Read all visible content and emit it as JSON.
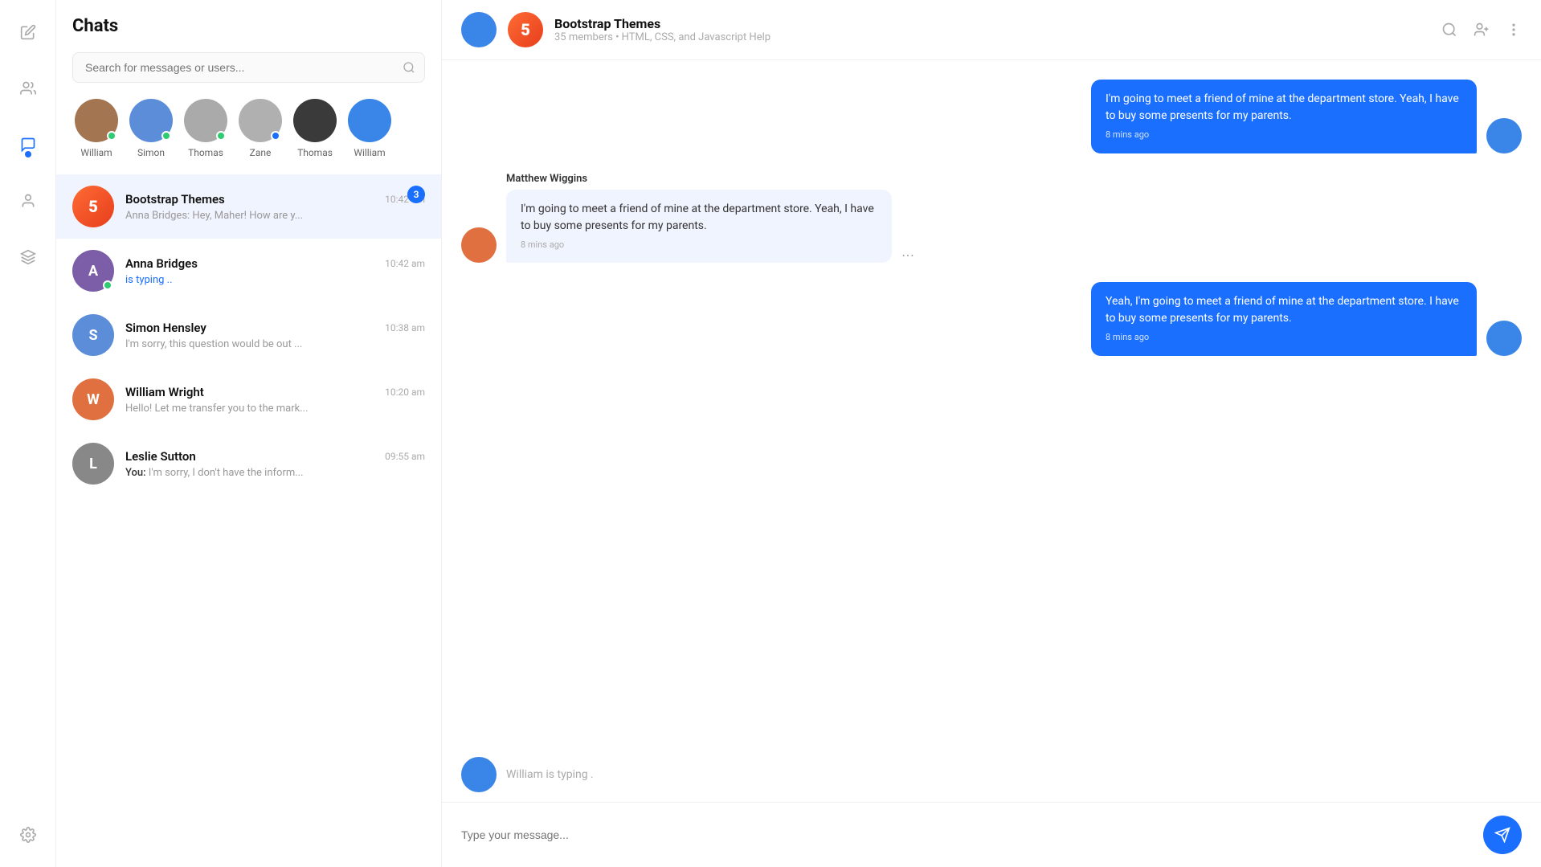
{
  "app": {
    "title": "Chats"
  },
  "nav": {
    "icons": [
      {
        "name": "edit-icon",
        "label": "Edit"
      },
      {
        "name": "contacts-icon",
        "label": "Contacts"
      },
      {
        "name": "chat-icon",
        "label": "Chat",
        "active": true
      },
      {
        "name": "user-icon",
        "label": "User"
      },
      {
        "name": "layers-icon",
        "label": "Layers"
      }
    ],
    "bottom": [
      {
        "name": "settings-icon",
        "label": "Settings"
      }
    ]
  },
  "sidebar": {
    "title": "Chats",
    "search": {
      "placeholder": "Search for messages or users..."
    },
    "active_users": [
      {
        "id": "william",
        "name": "William",
        "color": "#a47551",
        "online": true,
        "dot": "green"
      },
      {
        "id": "simon",
        "name": "Simon",
        "color": "#5b8dd9",
        "online": true,
        "dot": "green"
      },
      {
        "id": "thomas1",
        "name": "Thomas",
        "color": "#888",
        "online": true,
        "dot": "green"
      },
      {
        "id": "zane",
        "name": "Zane",
        "color": "#b0b0b0",
        "online": true,
        "dot": "blue"
      },
      {
        "id": "thomas2",
        "name": "Thomas",
        "color": "#3a3a3a",
        "online": false,
        "dot": ""
      },
      {
        "id": "william2",
        "name": "William",
        "color": "#3a86e8",
        "online": false,
        "dot": ""
      }
    ],
    "chats": [
      {
        "id": "bootstrap-themes",
        "name": "Bootstrap Themes",
        "time": "10:42 am",
        "preview": "Anna Bridges: Hey, Maher! How are y...",
        "badge": "3",
        "is_group": true,
        "group_color": "#e63e1c",
        "group_icon": "5"
      },
      {
        "id": "anna-bridges",
        "name": "Anna Bridges",
        "time": "10:42 am",
        "preview": "is typing ..",
        "typing": true,
        "color": "#7b5ea7",
        "online": true
      },
      {
        "id": "simon-hensley",
        "name": "Simon Hensley",
        "time": "10:38 am",
        "preview": "I'm sorry, this question would be out ...",
        "color": "#5b8dd9"
      },
      {
        "id": "william-wright",
        "name": "William Wright",
        "time": "10:20 am",
        "preview": "Hello! Let me transfer you to the mark...",
        "color": "#e07040"
      },
      {
        "id": "leslie-sutton",
        "name": "Leslie Sutton",
        "time": "09:55 am",
        "preview_label": "You:",
        "preview": " I'm sorry, I don't have the inform...",
        "color": "#666"
      }
    ]
  },
  "chat_header": {
    "name": "Bootstrap Themes",
    "sub": "35 members  •  HTML, CSS, and Javascript Help"
  },
  "messages": [
    {
      "id": "msg1",
      "type": "outgoing",
      "text": "I'm going to meet a friend of mine at the department store. Yeah, I have to buy some presents for my parents.",
      "time": "8 mins ago",
      "avatar_color": "#3a86e8"
    },
    {
      "id": "msg2",
      "type": "incoming",
      "sender": "Matthew Wiggins",
      "text": "I'm going to meet a friend of mine at the department store. Yeah, I have to buy some presents for my parents.",
      "time": "8 mins ago",
      "avatar_color": "#e07040"
    },
    {
      "id": "msg3",
      "type": "outgoing",
      "text": "Yeah, I'm going to meet a friend of mine at the department store. I have to buy some presents for my parents.",
      "time": "8 mins ago",
      "avatar_color": "#3a86e8"
    }
  ],
  "typing_indicator": {
    "text": "William is typing .",
    "avatar_color": "#3a86e8"
  },
  "input": {
    "placeholder": "Type your message..."
  }
}
